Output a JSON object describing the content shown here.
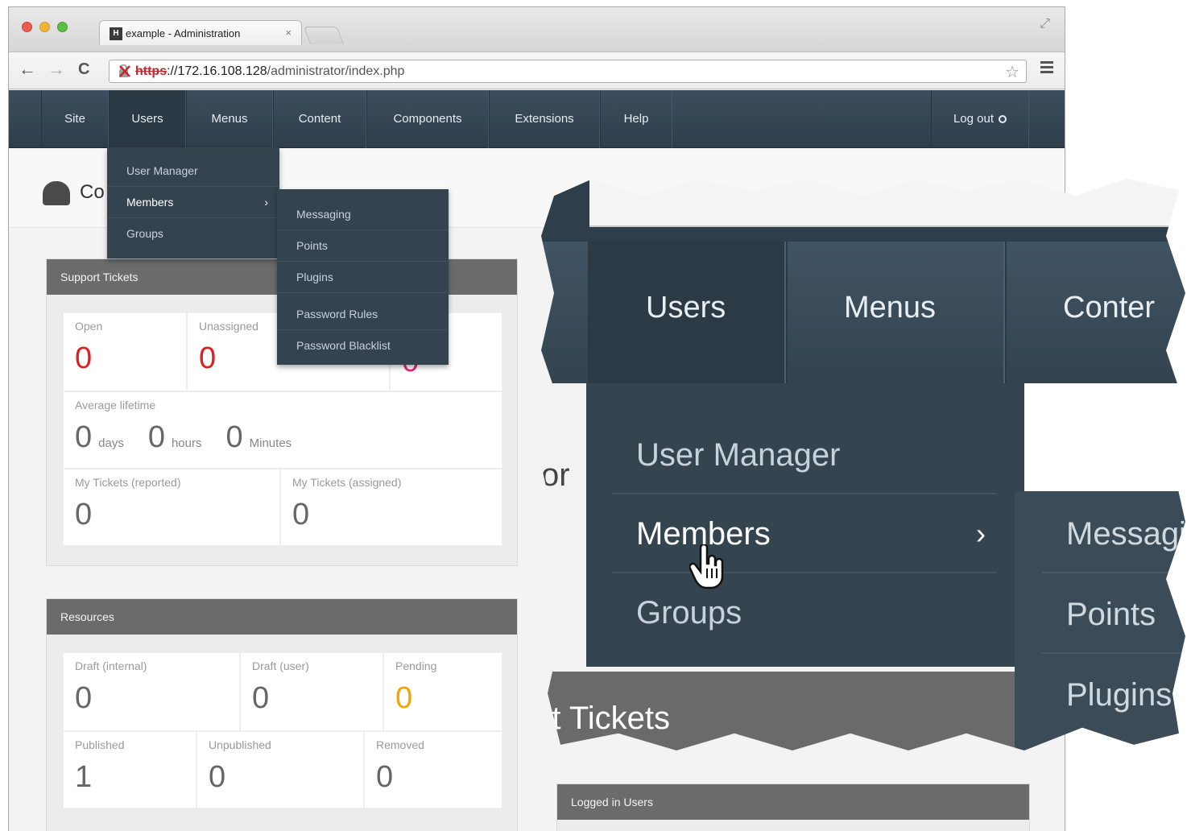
{
  "browser": {
    "tab_title": "example - Administration",
    "tab_favicon": "H",
    "tab_close": "×",
    "url_scheme": "https",
    "url_host": "://172.16.108.128",
    "url_path": "/administrator/index.php",
    "icons": [
      "back-arrow-icon",
      "forward-arrow-icon",
      "reload-icon",
      "broken-lock-icon",
      "star-icon",
      "menu-icon",
      "resize-icon"
    ]
  },
  "nav": {
    "items": [
      {
        "label": "Site"
      },
      {
        "label": "Users"
      },
      {
        "label": "Menus"
      },
      {
        "label": "Content"
      },
      {
        "label": "Components"
      },
      {
        "label": "Extensions"
      },
      {
        "label": "Help"
      }
    ],
    "logout_label": "Log out"
  },
  "page": {
    "title_fragment": "Co"
  },
  "users_menu": {
    "items": [
      {
        "label": "User Manager"
      },
      {
        "label": "Members"
      },
      {
        "label": "Groups"
      }
    ],
    "arrow": "›"
  },
  "members_submenu": {
    "items": [
      {
        "label": "Messaging"
      },
      {
        "label": "Points"
      },
      {
        "label": "Plugins"
      },
      {
        "label": "Password Rules"
      },
      {
        "label": "Password Blacklist"
      }
    ]
  },
  "support_tickets": {
    "header": "Support Tickets",
    "open_label": "Open",
    "open_value": "0",
    "unassigned_label": "Unassigned",
    "unassigned_value": "0",
    "third_value": "0",
    "avg_label": "Average lifetime",
    "avg_days": "0",
    "avg_days_unit": "days",
    "avg_hours": "0",
    "avg_hours_unit": "hours",
    "avg_minutes": "0",
    "avg_minutes_unit": "Minutes",
    "reported_label": "My Tickets (reported)",
    "reported_value": "0",
    "assigned_label": "My Tickets (assigned)",
    "assigned_value": "0"
  },
  "resources": {
    "header": "Resources",
    "draft_internal_label": "Draft (internal)",
    "draft_internal_value": "0",
    "draft_user_label": "Draft (user)",
    "draft_user_value": "0",
    "pending_label": "Pending",
    "pending_value": "0",
    "published_label": "Published",
    "published_value": "1",
    "unpublished_label": "Unpublished",
    "unpublished_value": "0",
    "removed_label": "Removed",
    "removed_value": "0"
  },
  "logged_in": {
    "header": "Logged in Users"
  },
  "zoom": {
    "nav_users": "Users",
    "nav_menus": "Menus",
    "nav_content": "Conter",
    "menu_user_manager": "User Manager",
    "menu_members": "Members",
    "menu_groups": "Groups",
    "arrow": "›",
    "sub_messaging": "Messagi",
    "sub_points": "Points",
    "sub_plugins": "Plugins",
    "panel_fragment": "rt Tickets",
    "page_fragment": "or"
  },
  "colors": {
    "nav_bg": "#34444f",
    "value_red": "#e02020",
    "value_pink": "#e7287b",
    "value_orange": "#f4a300",
    "panel_head": "#6b6b6b"
  }
}
